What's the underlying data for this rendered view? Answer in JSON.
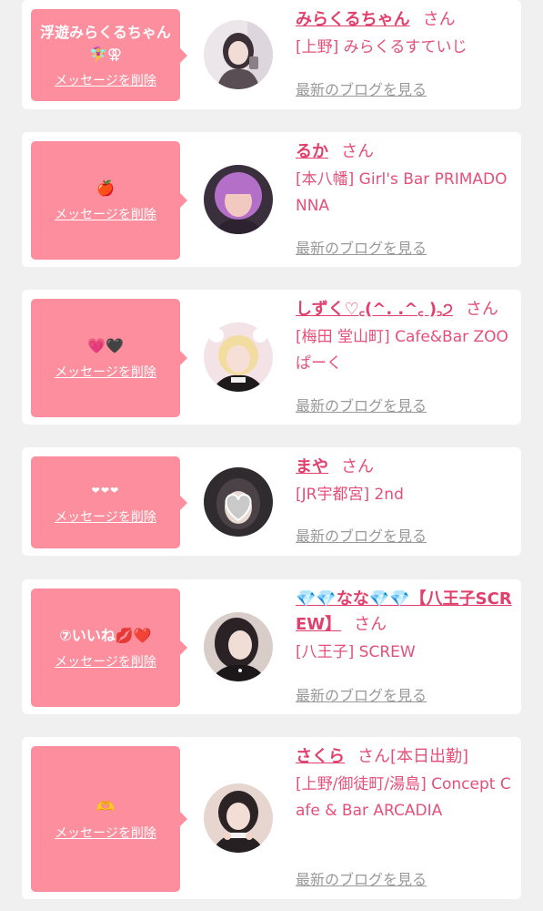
{
  "common": {
    "delete_label": "メッセージを削除",
    "blog_label": "最新のブログを見る",
    "honorific": "さん"
  },
  "cards": [
    {
      "message": "浮遊みらくるちゃん🧚‍♀️⚢",
      "name": "みらくるちゃん",
      "honorific": "さん",
      "shop": "[上野] みらくるすていじ"
    },
    {
      "message": "🍎",
      "name": "るか",
      "honorific": "さん",
      "shop": "[本八幡] Girl's Bar PRIMADONNA"
    },
    {
      "message": "💗🖤",
      "name": "しずく♡꜀(^.  .^꜀ )꜆੭",
      "honorific": "さん",
      "shop": "[梅田 堂山町] Cafe&Bar ZOOぱーく"
    },
    {
      "message": "❤❤❤",
      "name": "まや",
      "honorific": "さん",
      "shop": "[JR宇都宮] 2nd"
    },
    {
      "message": "⑦いいね💋❤️",
      "name": "💎💎なな💎💎【八王子SCREW】",
      "honorific": "さん",
      "shop": "[八王子] SCREW"
    },
    {
      "message": "🫶",
      "name": "さくら",
      "honorific": "さん[本日出勤]",
      "shop": "[上野/御徒町/湯島] Concept Cafe & Bar ARCADIA"
    }
  ],
  "colors": {
    "bubble": "#fc8e9d",
    "name": "#e0406c",
    "text_pink": "#e4507a",
    "link_gray": "#999999",
    "background": "#f1f0f1"
  }
}
